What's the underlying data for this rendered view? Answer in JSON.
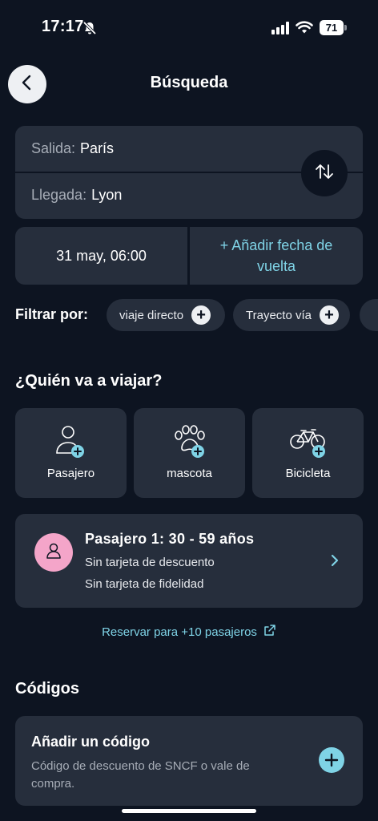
{
  "status_bar": {
    "time": "17:17",
    "battery": "71",
    "icons": [
      "bell-off-icon",
      "signal-icon",
      "wifi-icon",
      "battery-icon"
    ]
  },
  "header": {
    "title": "Búsqueda",
    "back_icon": "chevron-left-icon"
  },
  "route": {
    "origin_label": "Salida:",
    "origin_value": "París",
    "destination_label": "Llegada:",
    "destination_value": "Lyon",
    "swap_icon": "swap-vertical-icon"
  },
  "dates": {
    "outbound": "31 may, 06:00",
    "return_action": "+ Añadir fecha de vuelta"
  },
  "filters": {
    "label": "Filtrar por:",
    "chips": [
      {
        "label": "viaje directo",
        "icon": "plus-icon"
      },
      {
        "label": "Trayecto vía",
        "icon": "plus-icon"
      }
    ]
  },
  "travellers": {
    "title": "¿Quién va a viajar?",
    "options": [
      {
        "label": "Pasajero",
        "icon": "person-add-icon"
      },
      {
        "label": "mascota",
        "icon": "paw-add-icon"
      },
      {
        "label": "Bicicleta",
        "icon": "bicycle-add-icon"
      }
    ],
    "passenger": {
      "title": "Pasajero 1: 30 - 59 años",
      "discount": "Sin tarjeta de descuento",
      "loyalty": "Sin tarjeta de fidelidad",
      "avatar_icon": "person-icon",
      "chevron_icon": "chevron-right-icon"
    },
    "group_link": "Reservar para +10 pasajeros",
    "group_link_icon": "external-link-icon"
  },
  "codes": {
    "title": "Códigos",
    "card_title": "Añadir un código",
    "card_description": "Código de descuento de SNCF o vale de compra.",
    "add_icon": "plus-circle-icon"
  },
  "colors": {
    "background": "#0d1421",
    "card": "#262e3c",
    "accent": "#7fd3e6",
    "avatar": "#f4a5c9"
  }
}
